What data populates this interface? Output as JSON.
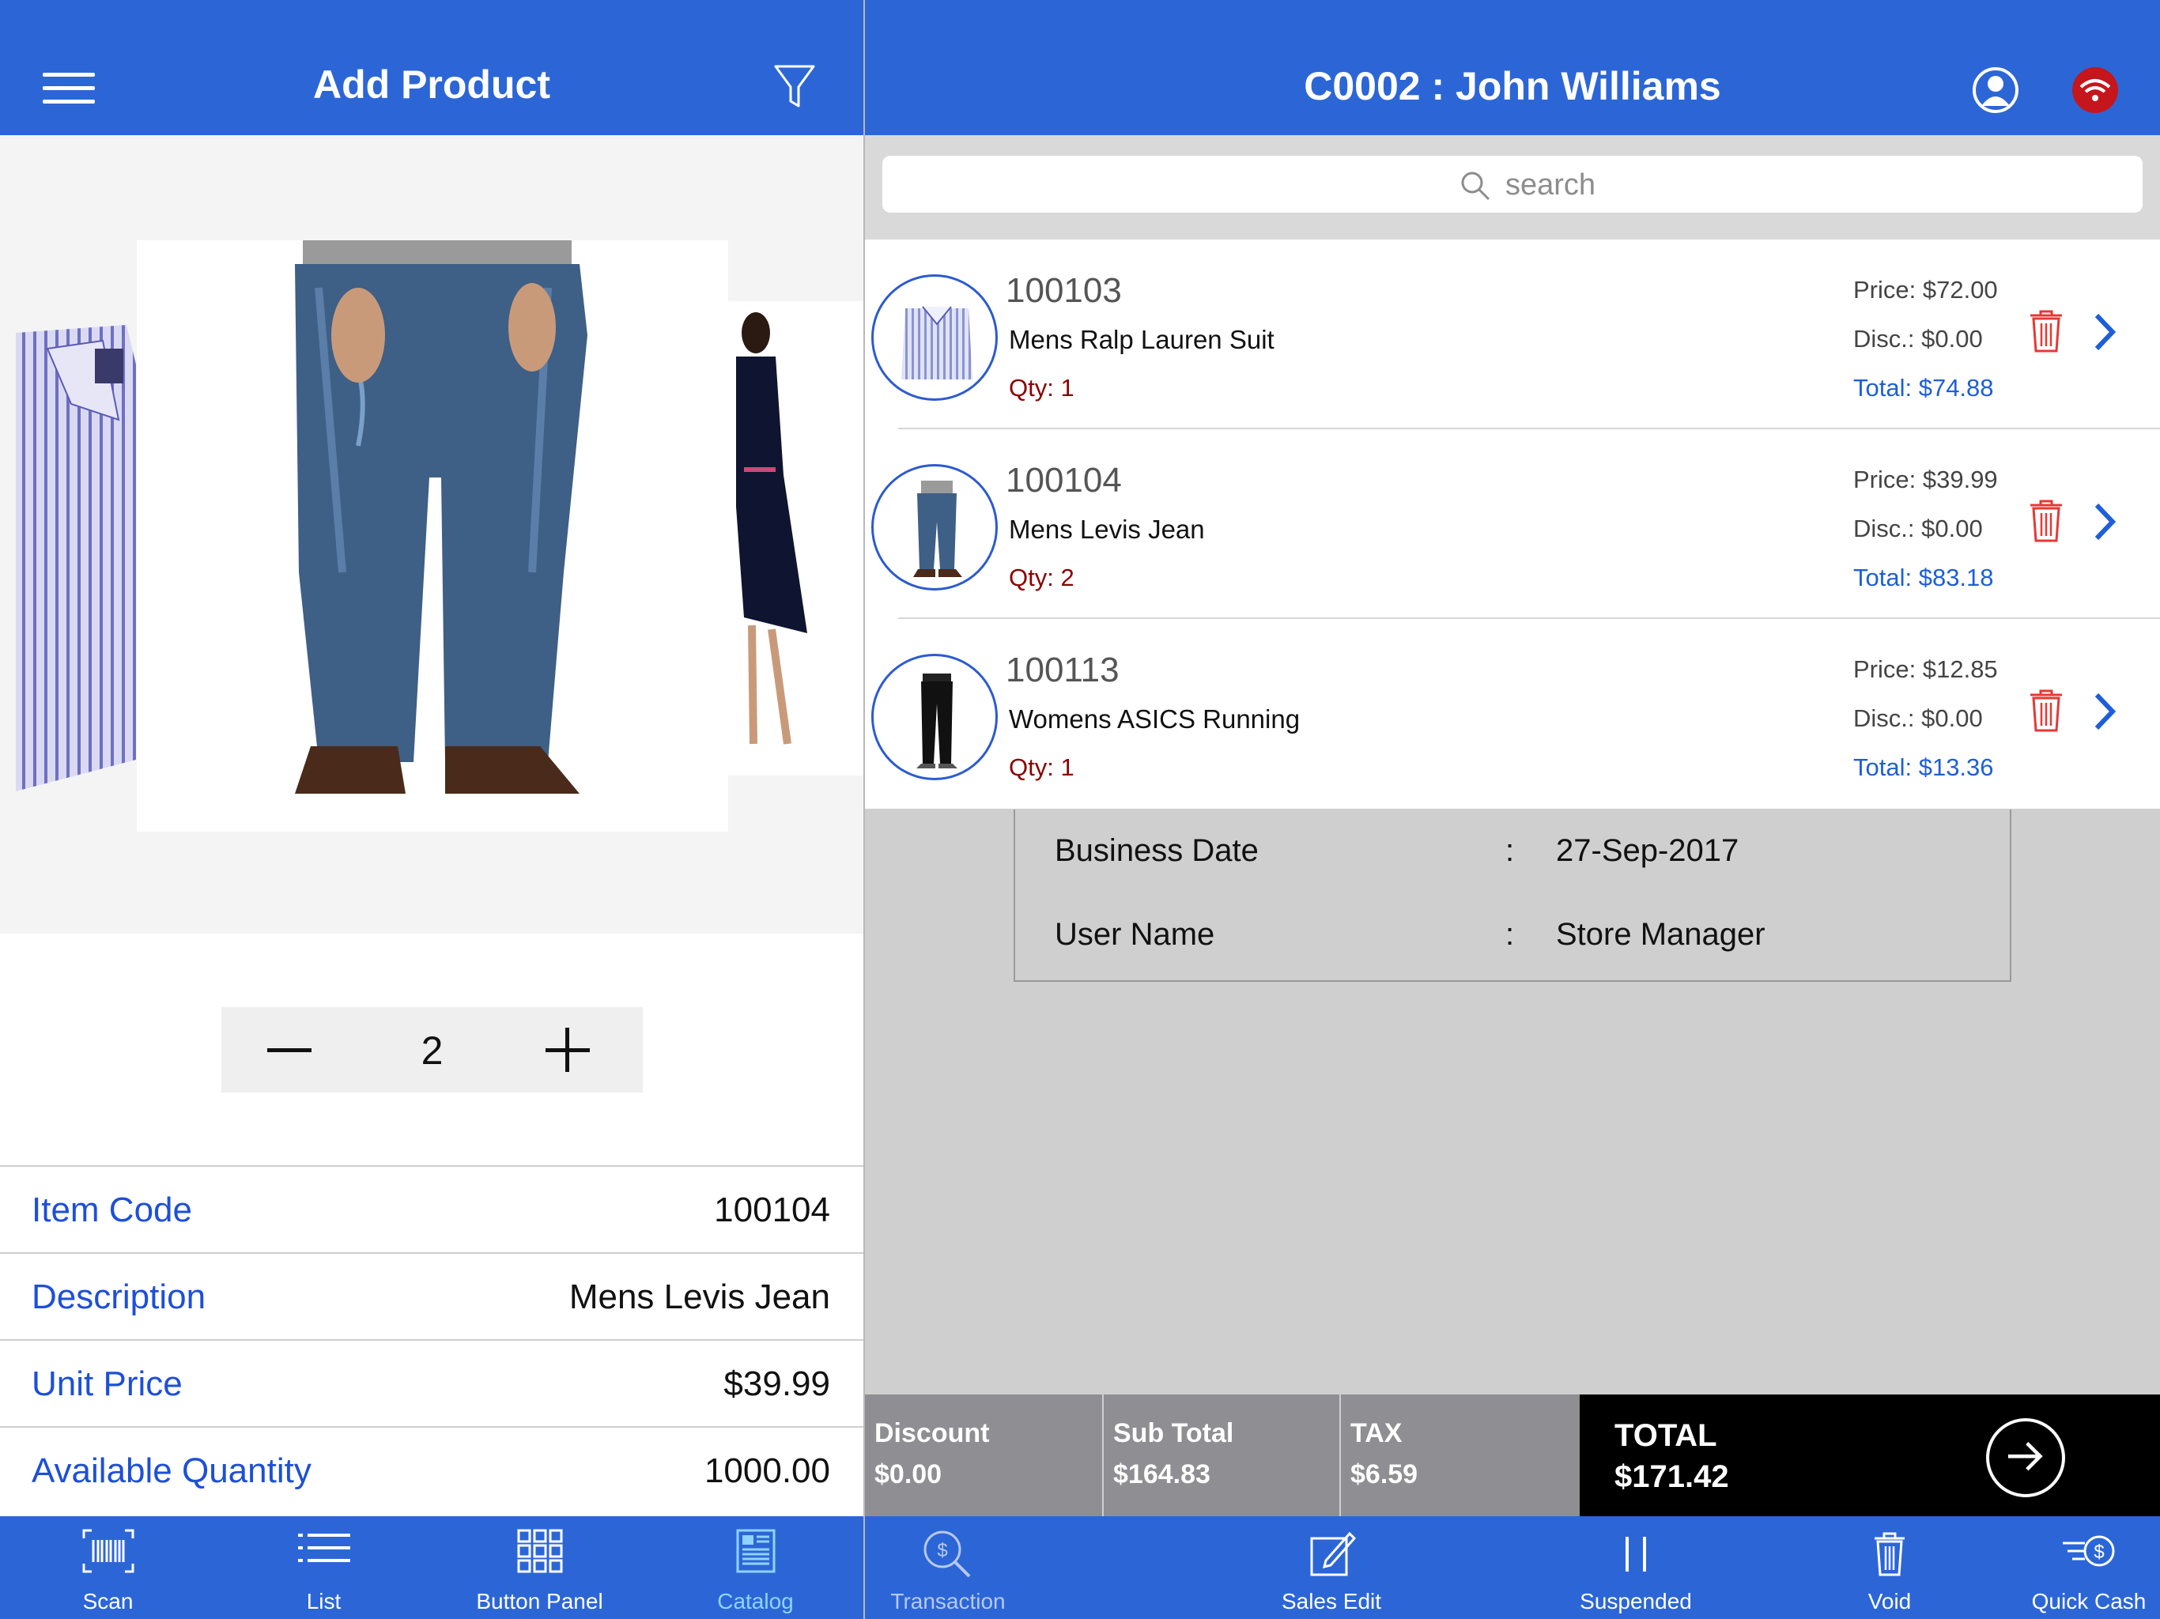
{
  "left_panel": {
    "title": "Add Product",
    "quantity": "2",
    "details": [
      {
        "label": "Item Code",
        "value": "100104"
      },
      {
        "label": "Description",
        "value": "Mens Levis Jean"
      },
      {
        "label": "Unit Price",
        "value": "$39.99"
      },
      {
        "label": "Available Quantity",
        "value": "1000.00"
      }
    ],
    "tabs": [
      {
        "label": "Scan",
        "icon": "barcode-icon",
        "active": false
      },
      {
        "label": "List",
        "icon": "list-icon",
        "active": false
      },
      {
        "label": "Button Panel",
        "icon": "grid-icon",
        "active": false
      },
      {
        "label": "Catalog",
        "icon": "catalog-icon",
        "active": true
      }
    ]
  },
  "right_panel": {
    "customer_title": "C0002 : John Williams",
    "search": {
      "placeholder": "search"
    },
    "cart_items": [
      {
        "code": "100103",
        "name": "Mens Ralp Lauren Suit",
        "qty": "Qty: 1",
        "price": "Price: $72.00",
        "disc": "Disc.: $0.00",
        "total": "Total: $74.88"
      },
      {
        "code": "100104",
        "name": "Mens Levis Jean",
        "qty": "Qty: 2",
        "price": "Price: $39.99",
        "disc": "Disc.: $0.00",
        "total": "Total: $83.18"
      },
      {
        "code": "100113",
        "name": "Womens ASICS Running",
        "qty": "Qty: 1",
        "price": "Price: $12.85",
        "disc": "Disc.: $0.00",
        "total": "Total: $13.36"
      }
    ],
    "info": [
      {
        "key": "Business Date",
        "colon": ":",
        "value": "27-Sep-2017"
      },
      {
        "key": "User Name",
        "colon": ":",
        "value": "Store Manager"
      }
    ],
    "totals": {
      "discount_label": "Discount",
      "discount_value": "$0.00",
      "subtotal_label": "Sub Total",
      "subtotal_value": "$164.83",
      "tax_label": "TAX",
      "tax_value": "$6.59",
      "total_label": "TOTAL",
      "total_value": "$171.42"
    },
    "tabs": [
      {
        "label": "Transaction",
        "icon": "transaction-search-icon",
        "enabled": false
      },
      {
        "label": "Sales Edit",
        "icon": "edit-icon",
        "enabled": true
      },
      {
        "label": "Suspended",
        "icon": "pause-icon",
        "enabled": true
      },
      {
        "label": "Void",
        "icon": "trash-icon",
        "enabled": true
      },
      {
        "label": "Quick Cash",
        "icon": "quick-cash-icon",
        "enabled": true
      }
    ]
  },
  "colors": {
    "brand_blue": "#2c66d6",
    "label_blue": "#1d4fd8",
    "qty_red": "#8b0000",
    "delete_red": "#e53935",
    "total_black": "#000000",
    "totals_gray": "#8e8e93",
    "content_gray": "#cfcfcf"
  }
}
